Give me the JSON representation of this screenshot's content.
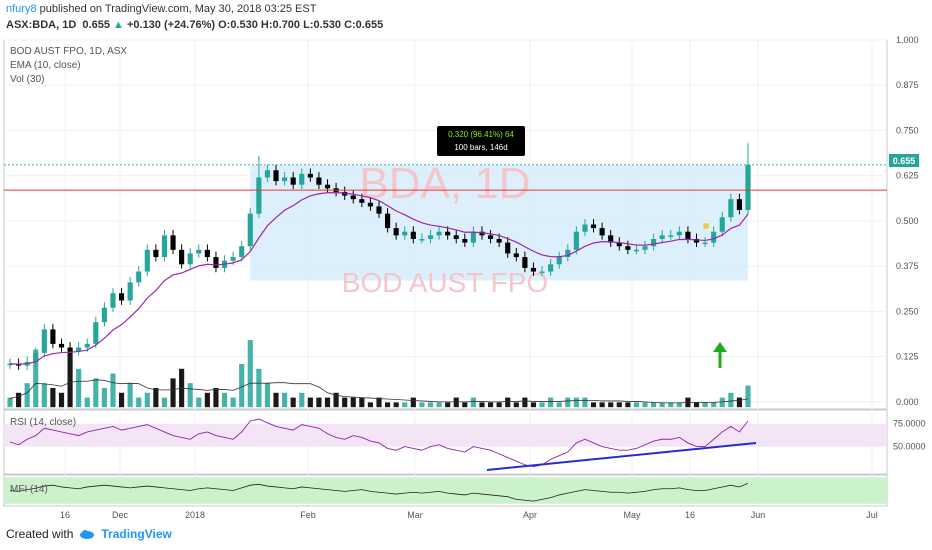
{
  "header": {
    "author": "nfury8",
    "published": "published on TradingView.com, May 30, 2018 03:25 EST",
    "ticker_line": "ASX:BDA, 1D",
    "price": "0.655",
    "change": "+0.130 (+24.76%)",
    "ohlc": "O:0.530 H:0.700 L:0.530 C:0.655"
  },
  "legend": {
    "title": "BOD AUST FPO, 1D, ASX",
    "ema": "EMA (10, close)",
    "vol": "Vol (30)",
    "rsi": "RSI (14, close)",
    "mfi": "MFI (14)"
  },
  "watermark": {
    "symbol": "BDA, 1D",
    "name": "BOD AUST FPO"
  },
  "measure": {
    "line1": "0.320 (96.41%) 64",
    "line2": "100 bars, 146d"
  },
  "last_price_label": "0.655",
  "footer": {
    "created_with": "Created with",
    "brand": "TradingView"
  },
  "colors": {
    "up": "#26a69a",
    "down": "#000000",
    "ema": "#9c27b0",
    "resistance": "#e53935",
    "range_box": "#d6ecfa",
    "rsi_band": "#f3e5f5",
    "mfi_band": "#ccf2cc",
    "trendline": "#2b2bd4",
    "arrow": "#1eab1e"
  },
  "chart_data": {
    "type": "candlestick",
    "title": "BOD AUST FPO, 1D, ASX",
    "price_axis": {
      "ticks": [
        "1.000",
        "0.875",
        "0.750",
        "0.625",
        "0.500",
        "0.375",
        "0.250",
        "0.125",
        "0.000"
      ],
      "ylim": [
        -0.02,
        1.0
      ]
    },
    "time_axis": {
      "ticks": [
        "16",
        "Dec",
        "2018",
        "Feb",
        "Mar",
        "Apr",
        "May",
        "16",
        "Jun",
        "Jul"
      ]
    },
    "rsi_axis": {
      "ticks": [
        "75.0000",
        "50.0000"
      ]
    },
    "resistance_level": 0.585,
    "price_path": [
      0.105,
      0.1,
      0.11,
      0.135,
      0.2,
      0.16,
      0.15,
      0.14,
      0.15,
      0.16,
      0.22,
      0.26,
      0.3,
      0.28,
      0.33,
      0.36,
      0.42,
      0.4,
      0.46,
      0.42,
      0.38,
      0.41,
      0.42,
      0.4,
      0.37,
      0.39,
      0.4,
      0.43,
      0.52,
      0.62,
      0.64,
      0.61,
      0.62,
      0.6,
      0.63,
      0.62,
      0.6,
      0.59,
      0.58,
      0.57,
      0.56,
      0.55,
      0.54,
      0.52,
      0.48,
      0.46,
      0.47,
      0.45,
      0.45,
      0.46,
      0.47,
      0.46,
      0.45,
      0.44,
      0.47,
      0.46,
      0.45,
      0.44,
      0.41,
      0.4,
      0.37,
      0.36,
      0.36,
      0.38,
      0.4,
      0.42,
      0.47,
      0.49,
      0.48,
      0.46,
      0.44,
      0.43,
      0.42,
      0.42,
      0.43,
      0.45,
      0.46,
      0.46,
      0.47,
      0.45,
      0.44,
      0.44,
      0.47,
      0.51,
      0.56,
      0.53,
      0.655
    ],
    "volume_path": [
      0.02,
      0.03,
      0.05,
      0.12,
      0.05,
      0.04,
      0.03,
      0.12,
      0.08,
      0.02,
      0.06,
      0.04,
      0.07,
      0.03,
      0.05,
      0.02,
      0.03,
      0.04,
      0.02,
      0.06,
      0.08,
      0.05,
      0.02,
      0.03,
      0.04,
      0.03,
      0.02,
      0.09,
      0.14,
      0.08,
      0.05,
      0.03,
      0.03,
      0.02,
      0.03,
      0.02,
      0.02,
      0.02,
      0.03,
      0.02,
      0.02,
      0.02,
      0.01,
      0.02,
      0.01,
      0.01,
      0.01,
      0.02,
      0.01,
      0.01,
      0.01,
      0.01,
      0.02,
      0.01,
      0.02,
      0.01,
      0.01,
      0.01,
      0.02,
      0.01,
      0.02,
      0.01,
      0.01,
      0.02,
      0.01,
      0.02,
      0.02,
      0.02,
      0.01,
      0.01,
      0.01,
      0.01,
      0.01,
      0.01,
      0.01,
      0.01,
      0.01,
      0.01,
      0.01,
      0.02,
      0.01,
      0.01,
      0.01,
      0.02,
      0.03,
      0.02,
      0.045
    ],
    "rsi_values": [
      55,
      52,
      58,
      62,
      70,
      68,
      66,
      64,
      62,
      66,
      68,
      70,
      72,
      68,
      70,
      72,
      74,
      70,
      66,
      62,
      60,
      58,
      64,
      66,
      62,
      60,
      58,
      66,
      78,
      80,
      76,
      72,
      70,
      68,
      74,
      72,
      70,
      64,
      60,
      58,
      62,
      60,
      56,
      54,
      48,
      46,
      50,
      48,
      46,
      50,
      52,
      48,
      46,
      44,
      50,
      48,
      46,
      42,
      38,
      34,
      30,
      28,
      30,
      36,
      40,
      44,
      54,
      58,
      54,
      50,
      48,
      46,
      46,
      48,
      52,
      56,
      58,
      58,
      60,
      54,
      50,
      50,
      58,
      66,
      72,
      66,
      78
    ],
    "mfi_values": [
      50,
      48,
      52,
      55,
      60,
      62,
      58,
      56,
      54,
      58,
      60,
      62,
      60,
      58,
      56,
      58,
      60,
      58,
      56,
      54,
      52,
      50,
      54,
      56,
      54,
      52,
      50,
      56,
      62,
      64,
      60,
      58,
      56,
      54,
      58,
      56,
      54,
      52,
      50,
      48,
      50,
      52,
      48,
      46,
      44,
      42,
      44,
      46,
      44,
      46,
      48,
      44,
      42,
      40,
      44,
      42,
      40,
      38,
      36,
      30,
      28,
      26,
      30,
      34,
      40,
      44,
      48,
      52,
      50,
      48,
      46,
      46,
      44,
      46,
      48,
      52,
      54,
      54,
      56,
      52,
      50,
      50,
      54,
      58,
      62,
      58,
      66
    ]
  }
}
